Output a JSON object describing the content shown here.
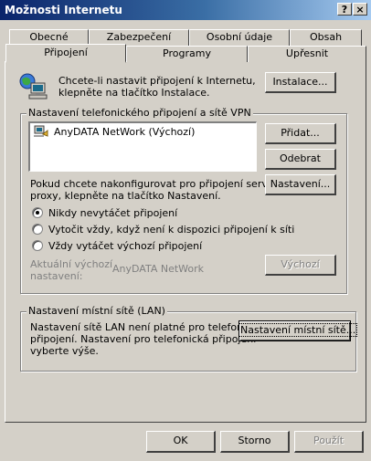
{
  "window": {
    "title": "Možnosti Internetu",
    "help_label": "?",
    "close_label": "×"
  },
  "tabs": {
    "row1": [
      "Obecné",
      "Zabezpečení",
      "Osobní údaje",
      "Obsah"
    ],
    "row2": [
      "Připojení",
      "Programy",
      "Upřesnit"
    ],
    "active": "Připojení"
  },
  "setup": {
    "text_line1": "Chcete-li nastavit připojení k Internetu,",
    "text_line2": "klepněte na tlačítko Instalace.",
    "install_button": "Instalace..."
  },
  "dialup_group": {
    "label": "Nastavení telefonického připojení a sítě VPN",
    "connections": [
      {
        "name": "AnyDATA NetWork (Výchozí)"
      }
    ],
    "add_button": "Přidat...",
    "remove_button": "Odebrat",
    "settings_text_line1": "Pokud chcete nakonfigurovat pro připojení server",
    "settings_text_line2": "proxy, klepněte na tlačítko Nastavení.",
    "settings_button": "Nastavení...",
    "radio_options": [
      "Nikdy nevytáčet připojení",
      "Vytočit vždy, když není k dispozici připojení k síti",
      "Vždy vytáčet výchozí připojení"
    ],
    "selected_option": 0,
    "current_default_label_line1": "Aktuální výchozí",
    "current_default_label_line2": "nastavení:",
    "current_default_value": "AnyDATA NetWork",
    "default_button": "Výchozí"
  },
  "lan_group": {
    "label": "Nastavení místní sítě (LAN)",
    "text_line1": "Nastavení sítě LAN není platné pro telefonická",
    "text_line2": "připojení. Nastavení pro telefonická připojení",
    "text_line3": "vyberte výše.",
    "lan_button": "Nastavení místní sítě..."
  },
  "footer": {
    "ok": "OK",
    "cancel": "Storno",
    "apply": "Použít"
  }
}
